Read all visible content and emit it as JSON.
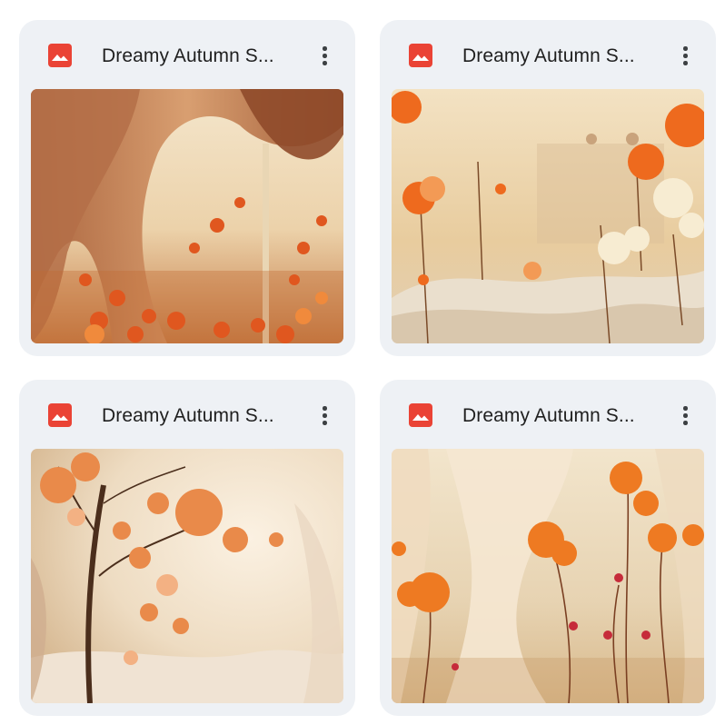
{
  "files": [
    {
      "name": "Dreamy Autumn S...",
      "type_icon": "image-file-icon",
      "menu_icon": "more-vert-icon"
    },
    {
      "name": "Dreamy Autumn S...",
      "type_icon": "image-file-icon",
      "menu_icon": "more-vert-icon"
    },
    {
      "name": "Dreamy Autumn S...",
      "type_icon": "image-file-icon",
      "menu_icon": "more-vert-icon"
    },
    {
      "name": "Dreamy Autumn S...",
      "type_icon": "image-file-icon",
      "menu_icon": "more-vert-icon"
    }
  ],
  "colors": {
    "card_background": "#eef1f5",
    "image_icon": "#ea4335",
    "title_text": "#1f1f1f"
  }
}
